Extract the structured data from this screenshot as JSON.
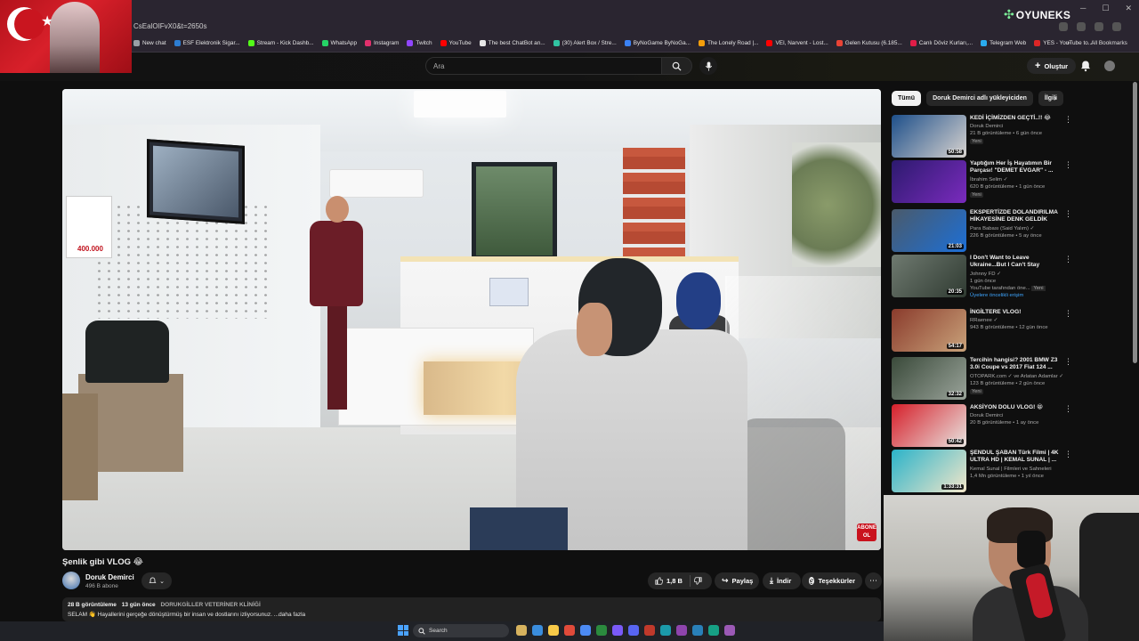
{
  "browser": {
    "url": "CsEalOIFvX0&t=2650s",
    "bookmarks": [
      {
        "label": "New chat",
        "color": "#9aa0a6"
      },
      {
        "label": "ESF Elektronik Sigar...",
        "color": "#2d7dd2"
      },
      {
        "label": "Stream - Kick Dashb...",
        "color": "#53fc18"
      },
      {
        "label": "WhatsApp",
        "color": "#25d366"
      },
      {
        "label": "Instagram",
        "color": "#e1306c"
      },
      {
        "label": "Twitch",
        "color": "#9146ff"
      },
      {
        "label": "YouTube",
        "color": "#ff0000"
      },
      {
        "label": "The best ChatBot an...",
        "color": "#e6e6e6"
      },
      {
        "label": "(30) Alert Box / Stre...",
        "color": "#31c3a2"
      },
      {
        "label": "ByNoGame ByNoGa...",
        "color": "#3b82f6"
      },
      {
        "label": "The Lonely Road |...",
        "color": "#f59e0b"
      },
      {
        "label": "VEI, Narvent - Lost...",
        "color": "#ff0000"
      },
      {
        "label": "Gelen Kutusu (6.185...",
        "color": "#ea4335"
      },
      {
        "label": "Canlı Döviz Kurları,...",
        "color": "#e11d48"
      },
      {
        "label": "Telegram Web",
        "color": "#2aabee"
      },
      {
        "label": "YES - YouTube to...",
        "color": "#dc2626"
      }
    ],
    "more_label": "»",
    "all_bookmarks": "All Bookmarks"
  },
  "overlay": {
    "logo_text": "OYUNEKS"
  },
  "header": {
    "search_placeholder": "Ara",
    "create_label": "Oluştur"
  },
  "video": {
    "title": "Şenlik gibi VLOG 😂",
    "channel": "Doruk Demirci",
    "subscribers": "496 B abone",
    "likes": "1,8 B",
    "share_label": "Paylaş",
    "download_label": "İndir",
    "thanks_label": "Teşekkürler",
    "views": "28 B görüntüleme",
    "age": "13 gün önce",
    "tag": "DORUKGİLLER VETERİNER KLİNİĞİ",
    "description": "SELAM 👋 Hayallerini gerçeğe dönüştürmüş bir insan ve dostlarını izliyorsunuz. ...daha fazla",
    "watermark": "ABONE OL"
  },
  "sidebar": {
    "chips": [
      "Tümü",
      "Doruk Demirci adlı yükleyiciden",
      "İlgili"
    ],
    "recommendations": [
      {
        "title": "KEDİ İÇİMİZDEN GEÇTİ..!! 😂",
        "channel": "Doruk Demirci",
        "stats": "21 B görüntüleme • 6 gün önce",
        "badge": "Yeni",
        "duration": "50:58",
        "thumb": [
          "#1d4f8a",
          "#d8d3cf"
        ]
      },
      {
        "title": "Yaptığım Her İş Hayatımın Bir Parçası! \"DEMET EVGAR\" - ...",
        "channel": "İbrahim Selim ✓",
        "stats": "620 B görüntüleme • 1 gün önce",
        "badge": "Yeni",
        "duration": "",
        "thumb": [
          "#2c1a6e",
          "#7a2bbd"
        ]
      },
      {
        "title": "EKSPERTİZDE DOLANDIRILMA HİKAYESİNE DENK GELDİK",
        "channel": "Para Babası (Said Yalım) ✓",
        "stats": "226 B görüntüleme • 5 ay önce",
        "badge": "",
        "duration": "21:03",
        "thumb": [
          "#4a5a6a",
          "#1d6fd6"
        ]
      },
      {
        "title": "I Don't Want to Leave Ukraine...But I Can't Stay",
        "channel": "Johnny FD ✓",
        "stats": "1 gün önce",
        "badge": "",
        "duration": "20:35",
        "thumb": [
          "#6f7a70",
          "#2f3a31"
        ],
        "extra": "YouTube tarafından öne...",
        "extra_badge": "Yeni",
        "extra2": "Üyelere öncelikli erişim"
      },
      {
        "title": "İNGİLTERE VLOG!",
        "channel": "RRaenee ✓",
        "stats": "943 B görüntüleme • 12 gün önce",
        "badge": "",
        "duration": "54:17",
        "thumb": [
          "#8a3b2c",
          "#c9a27a"
        ]
      },
      {
        "title": "Tercihin hangisi? 2001 BMW Z3 3.0i Coupe vs 2017 Fiat 124 ...",
        "channel": "OTOPARK.com ✓ ve Arlatan Adamlar ✓",
        "stats": "123 B görüntüleme • 2 gün önce",
        "badge": "Yeni",
        "duration": "32:32",
        "thumb": [
          "#3a4a3a",
          "#9aa39a"
        ]
      },
      {
        "title": "AKSİYON DOLU VLOG! 😁",
        "channel": "Doruk Demirci",
        "stats": "20 B görüntüleme • 1 ay önce",
        "badge": "",
        "duration": "50:42",
        "thumb": [
          "#d61f2a",
          "#e8e4e0"
        ]
      },
      {
        "title": "ŞENDUL ŞABAN Türk Filmi | 4K ULTRA HD | KEMAL SUNAL | ...",
        "channel": "Kemal Sunal | Filmleri ve Sahneleri",
        "stats": "1,4 Mn görüntüleme • 1 yıl önce",
        "badge": "",
        "duration": "1:33:31",
        "thumb": [
          "#2bb3c9",
          "#f2e6c9"
        ]
      }
    ]
  },
  "taskbar": {
    "search_label": "Search"
  }
}
